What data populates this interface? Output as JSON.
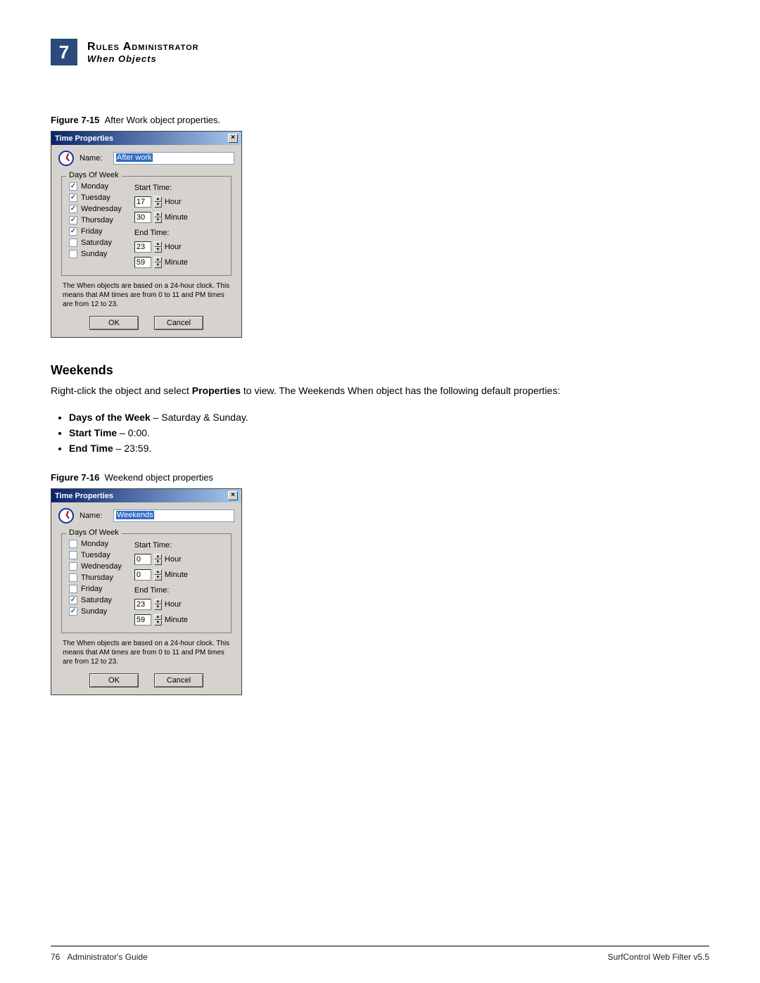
{
  "header": {
    "chapter_num": "7",
    "line1": "Rules Administrator",
    "line2": "When Objects"
  },
  "fig15": {
    "label": "Figure 7-15",
    "caption": "After Work object properties."
  },
  "fig16": {
    "label": "Figure 7-16",
    "caption": "Weekend object properties"
  },
  "section": {
    "title": "Weekends",
    "intro_a": "Right-click the object and select ",
    "intro_b": "Properties",
    "intro_c": " to view. The Weekends When object has the following default properties:",
    "b1_label": "Days of the Week",
    "b1_rest": " – Saturday & Sunday.",
    "b2_label": "Start Time",
    "b2_rest": " – 0:00.",
    "b3_label": "End Time",
    "b3_rest": " – 23:59."
  },
  "dlg": {
    "title": "Time Properties",
    "name_label": "Name:",
    "legend": "Days Of Week",
    "days": [
      "Monday",
      "Tuesday",
      "Wednesday",
      "Thursday",
      "Friday",
      "Saturday",
      "Sunday"
    ],
    "start_label": "Start Time:",
    "end_label": "End Time:",
    "hour_label": "Hour",
    "minute_label": "Minute",
    "note": "The When objects are based on a 24-hour clock. This means that AM times are from 0 to 11 and PM times are from 12 to 23.",
    "ok": "OK",
    "cancel": "Cancel"
  },
  "dlg1": {
    "name_value": "After work",
    "checks": [
      true,
      true,
      true,
      true,
      true,
      false,
      false
    ],
    "sh": "17",
    "sm": "30",
    "eh": "23",
    "em": "59"
  },
  "dlg2": {
    "name_value": "Weekends",
    "checks": [
      false,
      false,
      false,
      false,
      false,
      true,
      true
    ],
    "sh": "0",
    "sm": "0",
    "eh": "23",
    "em": "59"
  },
  "footer": {
    "left_page": "76",
    "left_text": "Administrator's Guide",
    "right": "SurfControl Web Filter v5.5"
  }
}
